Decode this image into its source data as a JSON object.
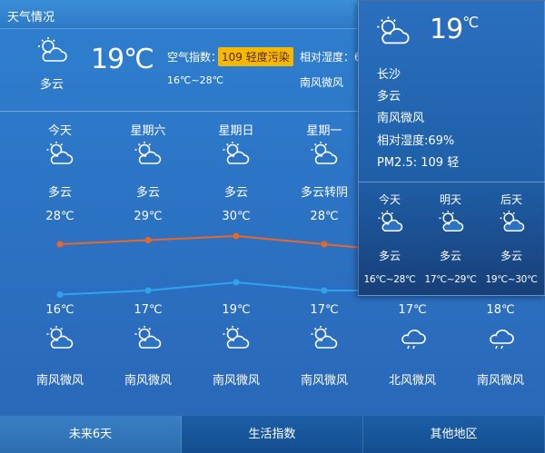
{
  "window": {
    "title": "天气情况"
  },
  "current": {
    "condition": "多云",
    "temp": "19℃",
    "aq_label": "空气指数：",
    "aq_value": "109 轻度污染",
    "range": "16℃~28℃",
    "humidity": "相对湿度：6",
    "wind": "南风微风"
  },
  "forecast": [
    {
      "day": "今天",
      "cond": "多云",
      "high": "28℃",
      "low": "16℃",
      "wind": "南风微风",
      "day_icon": "sun-cloud-icon",
      "night_icon": "sun-cloud-icon"
    },
    {
      "day": "星期六",
      "cond": "多云",
      "high": "29℃",
      "low": "17℃",
      "wind": "南风微风",
      "day_icon": "sun-cloud-icon",
      "night_icon": "sun-cloud-icon"
    },
    {
      "day": "星期日",
      "cond": "多云",
      "high": "30℃",
      "low": "19℃",
      "wind": "南风微风",
      "day_icon": "sun-cloud-icon",
      "night_icon": "sun-cloud-icon"
    },
    {
      "day": "星期一",
      "cond": "多云转阴",
      "high": "28℃",
      "low": "17℃",
      "wind": "南风微风",
      "day_icon": "sun-cloud-icon",
      "night_icon": "sun-cloud-icon"
    },
    {
      "day": "",
      "cond": "",
      "high": "",
      "low": "17℃",
      "wind": "北风微风",
      "day_icon": "",
      "night_icon": "cloud-rain-icon"
    },
    {
      "day": "",
      "cond": "",
      "high": "",
      "low": "18℃",
      "wind": "南风微风",
      "day_icon": "",
      "night_icon": "cloud-rain-icon"
    }
  ],
  "highs": [
    28,
    29,
    30,
    28,
    26,
    26
  ],
  "lows": [
    16,
    17,
    19,
    17,
    17,
    18
  ],
  "popup": {
    "temp": "19",
    "unit": "℃",
    "city": "长沙",
    "condition": "多云",
    "wind": "南风微风",
    "humidity": "相对湿度:69%",
    "pm25": "PM2.5: 109 轻",
    "days": [
      {
        "name": "今天",
        "cond": "多云",
        "range": "16℃~28℃"
      },
      {
        "name": "明天",
        "cond": "多云",
        "range": "17℃~29℃"
      },
      {
        "name": "后天",
        "cond": "多云",
        "range": "19℃~30℃"
      }
    ]
  },
  "tabs": [
    "未来6天",
    "生活指数",
    "其他地区"
  ],
  "colors": {
    "high_line": "#e8682a",
    "low_line": "#2fa3ef",
    "aq_badge": "#f5b800"
  }
}
